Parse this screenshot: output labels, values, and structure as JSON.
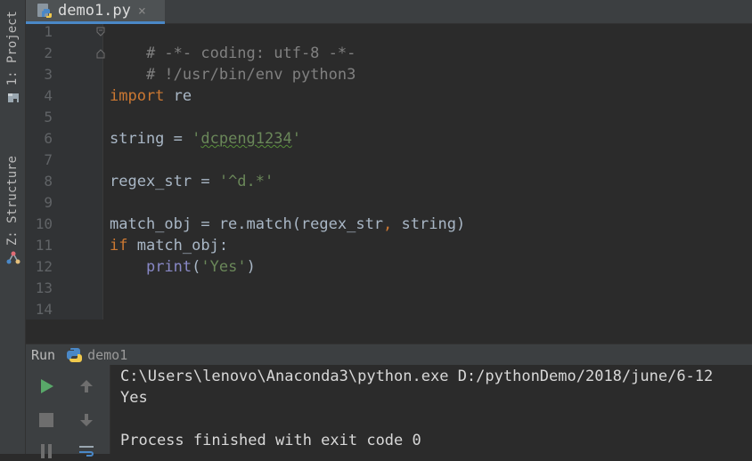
{
  "left_strip": {
    "project_tab": "1: Project",
    "structure_tab": "Z: Structure"
  },
  "editor_tab": {
    "title": "demo1.py",
    "close_glyph": "×"
  },
  "gutter": {
    "line_numbers": [
      "1",
      "2",
      "3",
      "4",
      "5",
      "6",
      "7",
      "8",
      "9",
      "10",
      "11",
      "12",
      "13",
      "14"
    ]
  },
  "code": {
    "line1": "# -*- coding: utf-8 -*-",
    "line2": "# !/usr/bin/env python3",
    "line4_kw": "import",
    "line4_rest": " re",
    "line6_var": "string = ",
    "line6_q1": "'",
    "line6_str": "dcpeng1234",
    "line6_q2": "'",
    "line8_var": "regex_str = ",
    "line8_str": "'^d.*'",
    "line10_a": "match_obj = re.match(regex_str",
    "line10_comma": ",",
    "line10_b": " string)",
    "line11_kw": "if",
    "line11_rest": " match_obj:",
    "line12_indent": "    ",
    "line12_fn": "print",
    "line12_open": "(",
    "line12_str": "'Yes'",
    "line12_close": ")"
  },
  "run_panel": {
    "label": "Run",
    "config": "demo1"
  },
  "console": {
    "line1": "C:\\Users\\lenovo\\Anaconda3\\python.exe D:/pythonDemo/2018/june/6-12",
    "line2": "Yes",
    "line3": "",
    "line4": "Process finished with exit code 0"
  },
  "colors": {
    "keyword": "#cc7832",
    "string": "#6a8759",
    "comment": "#808080",
    "builtin": "#8888c6",
    "run_green": "#59a869"
  },
  "icons": [
    "python-file-icon",
    "close-icon",
    "run-icon",
    "stop-icon",
    "up-arrow-icon",
    "down-arrow-icon",
    "soft-wrap-icon",
    "project-icon",
    "structure-icon"
  ]
}
